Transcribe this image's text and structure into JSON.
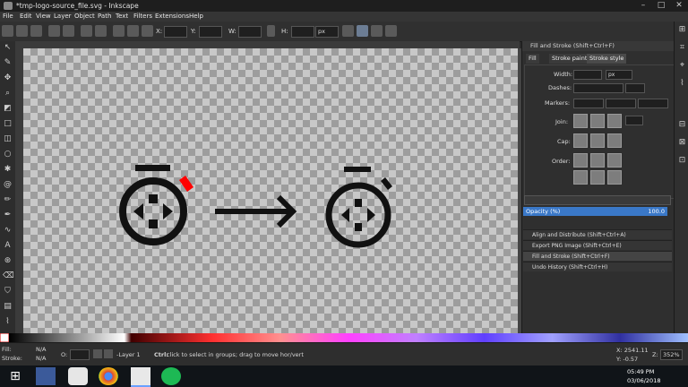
{
  "window": {
    "title": "*tmp-logo-source_file.svg - Inkscape"
  },
  "menu": [
    "File",
    "Edit",
    "View",
    "Layer",
    "Object",
    "Path",
    "Text",
    "Filters",
    "Extensions",
    "Help"
  ],
  "toolbar": {
    "x_label": "X:",
    "y_label": "Y:",
    "w_label": "W:",
    "h_label": "H:",
    "unit": "px"
  },
  "panel": {
    "title": "Fill and Stroke (Shift+Ctrl+F)",
    "tabs": [
      "Fill",
      "Stroke paint",
      "Stroke style"
    ],
    "width_label": "Width:",
    "width_unit": "px",
    "dashes_label": "Dashes:",
    "markers_label": "Markers:",
    "join_label": "Join:",
    "cap_label": "Cap:",
    "order_label": "Order:",
    "opacity_label": "Opacity (%)",
    "opacity_value": "100.0",
    "docked": [
      "Align and Distribute (Shift+Ctrl+A)",
      "Export PNG Image (Shift+Ctrl+E)",
      "Fill and Stroke (Shift+Ctrl+F)",
      "Undo History (Shift+Ctrl+H)"
    ]
  },
  "status": {
    "fill_label": "Fill:",
    "fill_value": "N/A",
    "stroke_label": "Stroke:",
    "stroke_value": "N/A",
    "o_label": "O:",
    "layer": "-Layer 1",
    "message_bold": "Ctrl:",
    "message": " click to select in groups; drag to move hor/vert",
    "x_coord": "X: 2541.11",
    "y_coord": "Y: -0.57",
    "zoom_label": "Z:",
    "zoom": "352%"
  },
  "taskbar": {
    "time": "05:49 PM",
    "date": "03/06/2018"
  },
  "colors": {
    "accent": "#3a78c8",
    "highlight": "#ff0000",
    "icon": "#111111"
  }
}
